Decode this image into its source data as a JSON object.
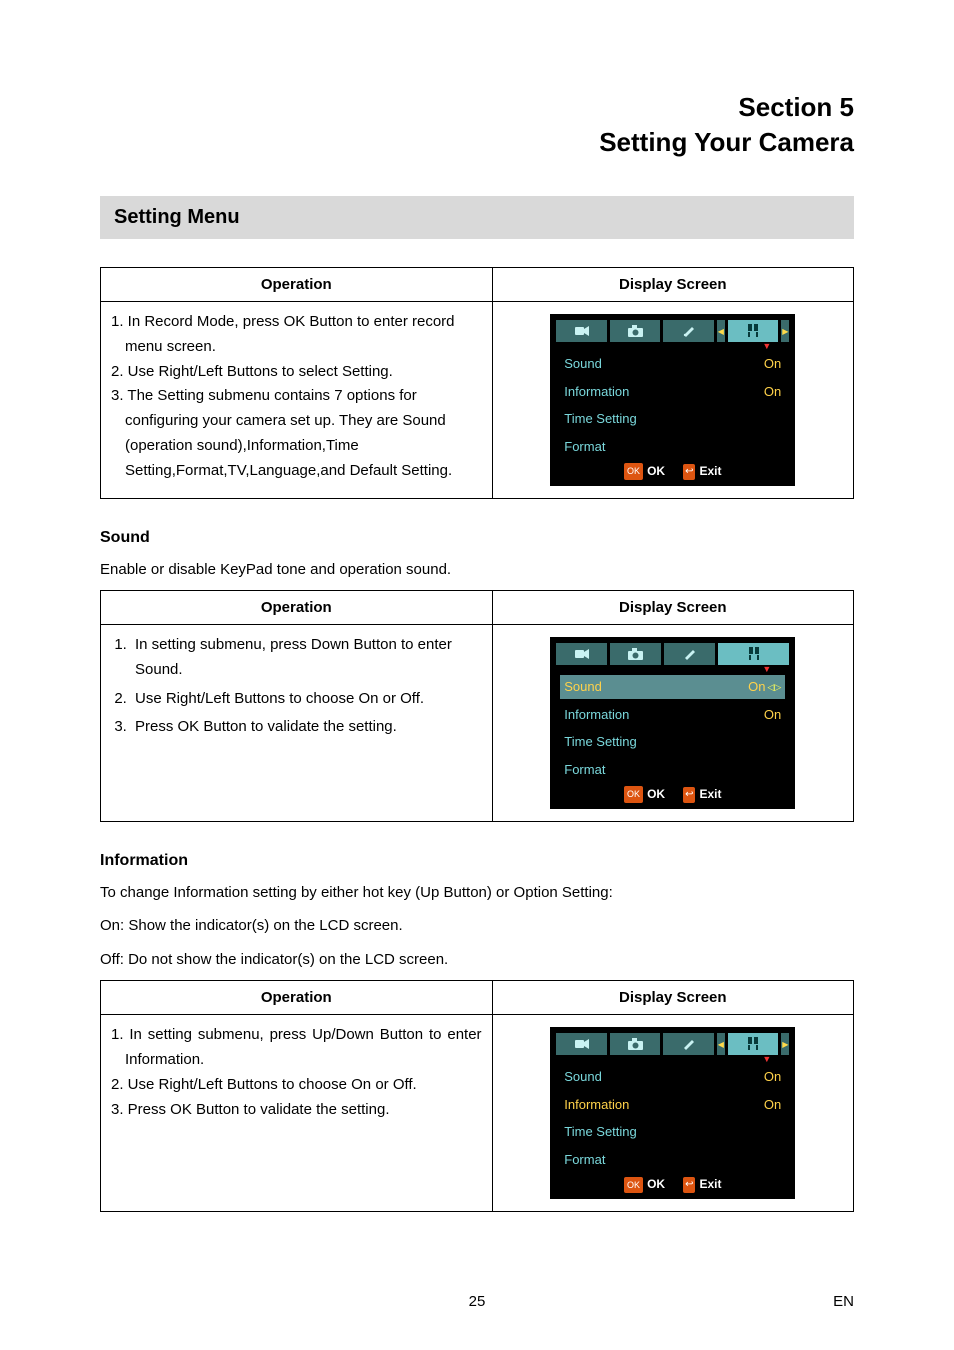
{
  "header": {
    "section": "Section 5",
    "title": "Setting Your Camera"
  },
  "setting_menu_label": "Setting Menu",
  "settingMenu": {
    "col_operation": "Operation",
    "col_display": "Display Screen",
    "step1": "1. In Record Mode, press OK Button to enter record menu screen.",
    "step2": "2. Use Right/Left Buttons to select Setting.",
    "step3": "3. The Setting submenu contains 7 options for configuring your camera set up. They are Sound (operation sound),Information,Time Setting,Format,TV,Language,and Default Setting."
  },
  "sound": {
    "heading": "Sound",
    "desc": "Enable or disable KeyPad tone and operation sound.",
    "col_operation": "Operation",
    "col_display": "Display Screen",
    "step1": "In setting submenu, press Down Button to enter Sound.",
    "step2": "Use Right/Left Buttons to choose On or Off.",
    "step3": "Press OK Button to validate the setting."
  },
  "information": {
    "heading": "Information",
    "desc1": "To change Information setting by either hot key (Up Button) or Option Setting:",
    "desc2": "On: Show the indicator(s) on the LCD screen.",
    "desc3": "Off: Do not show the indicator(s) on the LCD screen.",
    "col_operation": "Operation",
    "col_display": "Display Screen",
    "step1": "1. In setting submenu, press Up/Down Button to enter Information.",
    "step2": "2. Use Right/Left Buttons to choose On or Off.",
    "step3": "3. Press OK Button to validate the setting."
  },
  "lcd": {
    "rows": {
      "sound": "Sound",
      "information": "Information",
      "time": "Time Setting",
      "format": "Format"
    },
    "on": "On",
    "ok": "OK",
    "exit": "Exit"
  },
  "footer": {
    "page": "25",
    "lang": "EN"
  }
}
